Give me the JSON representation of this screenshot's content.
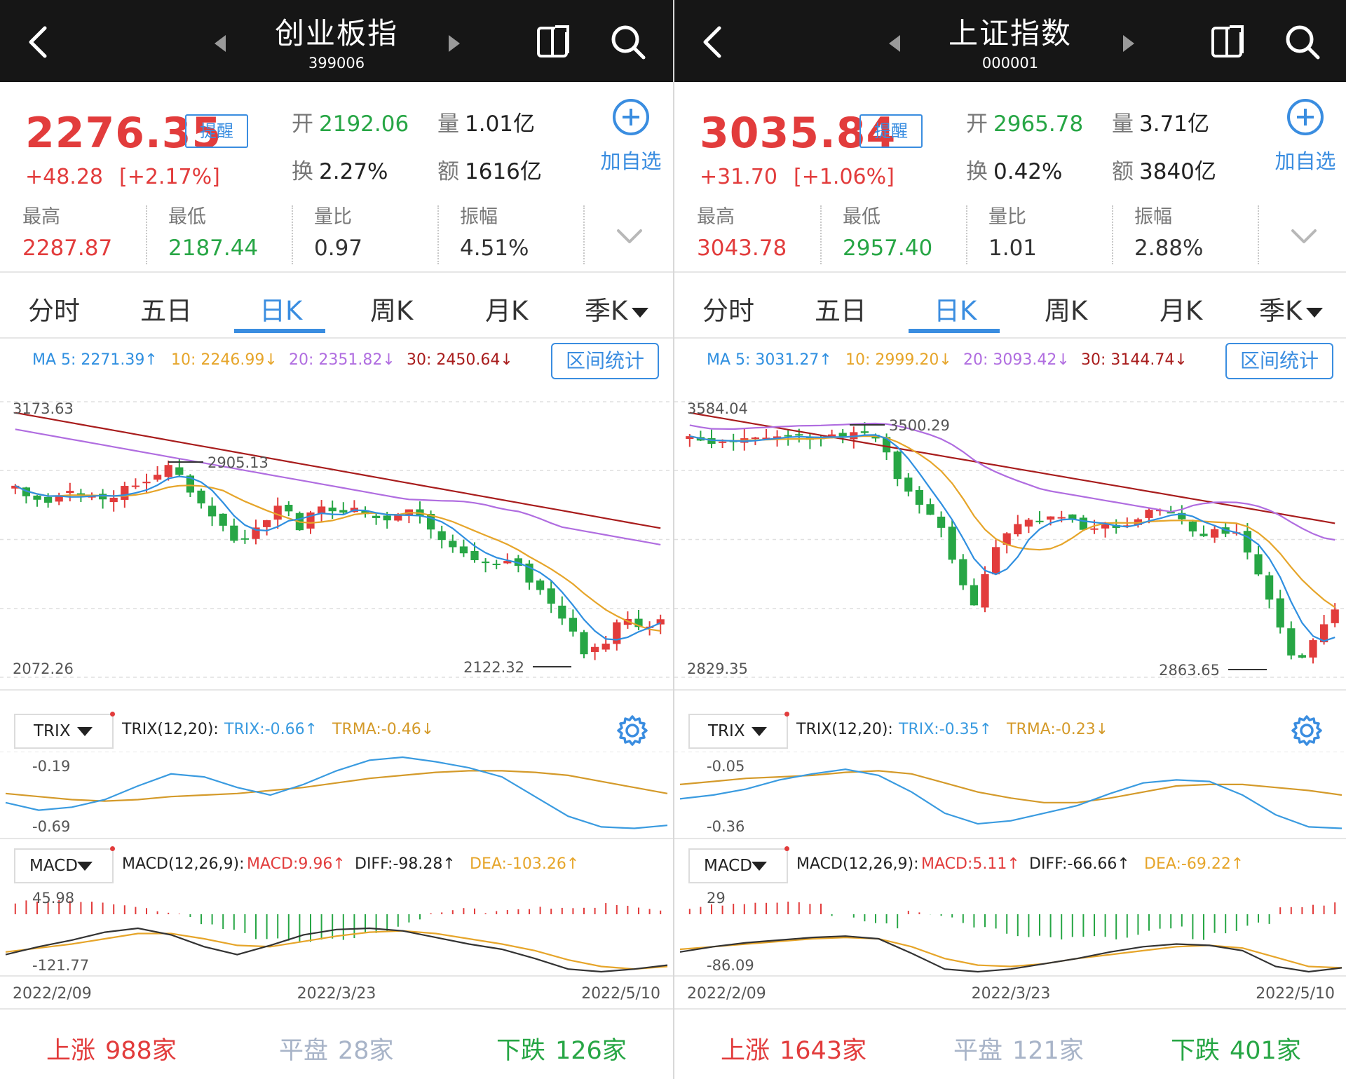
{
  "panels": [
    {
      "header": {
        "title": "创业板指",
        "code": "399006"
      },
      "quote": {
        "price": "2276.35",
        "alert_label": "提醒",
        "change": "+48.28",
        "change_pct": "[+2.17%]",
        "open_label": "开",
        "open": "2192.06",
        "volume_label": "量",
        "volume": "1.01亿",
        "turnover_label": "换",
        "turnover": "2.27%",
        "amount_label": "额",
        "amount": "1616亿",
        "add_fav_label": "加自选",
        "grid": [
          {
            "label": "最高",
            "value": "2287.87",
            "color": "red"
          },
          {
            "label": "最低",
            "value": "2187.44",
            "color": "green"
          },
          {
            "label": "量比",
            "value": "0.97",
            "color": "dark"
          },
          {
            "label": "振幅",
            "value": "4.51%",
            "color": "dark"
          }
        ]
      },
      "tabs": [
        "分时",
        "五日",
        "日K",
        "周K",
        "月K",
        "季K"
      ],
      "active_tab": "日K",
      "ma": {
        "ma5": "MA 5: 2271.39↑",
        "ma10": "10: 2246.99↓",
        "ma20": "20: 2351.82↓",
        "ma30": "30: 2450.64↓"
      },
      "range_btn": "区间统计",
      "kline": {
        "top_label": "3173.63",
        "bottom_label": "2072.26",
        "high_label": "2905.13",
        "low_label": "2122.32"
      },
      "trix": {
        "selector": "TRIX",
        "params": "TRIX(12,20):",
        "trix": "TRIX:-0.66↑",
        "trma": "TRMA:-0.46↓",
        "top": "-0.19",
        "bottom": "-0.69"
      },
      "macd": {
        "selector": "MACD",
        "params": "MACD(12,26,9):",
        "macd": "MACD:9.96↑",
        "diff": "DIFF:-98.28↑",
        "dea": "DEA:-103.26↑",
        "top": "45.98",
        "bottom": "-121.77"
      },
      "dates": [
        "2022/2/09",
        "2022/3/23",
        "2022/5/10"
      ],
      "footer": {
        "up_label": "上涨",
        "up": "988家",
        "flat_label": "平盘",
        "flat": "28家",
        "down_label": "下跌",
        "down": "126家"
      }
    },
    {
      "header": {
        "title": "上证指数",
        "code": "000001"
      },
      "quote": {
        "price": "3035.84",
        "alert_label": "提醒",
        "change": "+31.70",
        "change_pct": "[+1.06%]",
        "open_label": "开",
        "open": "2965.78",
        "volume_label": "量",
        "volume": "3.71亿",
        "turnover_label": "换",
        "turnover": "0.42%",
        "amount_label": "额",
        "amount": "3840亿",
        "add_fav_label": "加自选",
        "grid": [
          {
            "label": "最高",
            "value": "3043.78",
            "color": "red"
          },
          {
            "label": "最低",
            "value": "2957.40",
            "color": "green"
          },
          {
            "label": "量比",
            "value": "1.01",
            "color": "dark"
          },
          {
            "label": "振幅",
            "value": "2.88%",
            "color": "dark"
          }
        ]
      },
      "tabs": [
        "分时",
        "五日",
        "日K",
        "周K",
        "月K",
        "季K"
      ],
      "active_tab": "日K",
      "ma": {
        "ma5": "MA 5: 3031.27↑",
        "ma10": "10: 2999.20↓",
        "ma20": "20: 3093.42↓",
        "ma30": "30: 3144.74↓"
      },
      "range_btn": "区间统计",
      "kline": {
        "top_label": "3584.04",
        "bottom_label": "2829.35",
        "high_label": "3500.29",
        "low_label": "2863.65"
      },
      "trix": {
        "selector": "TRIX",
        "params": "TRIX(12,20):",
        "trix": "TRIX:-0.35↑",
        "trma": "TRMA:-0.23↓",
        "top": "-0.05",
        "bottom": "-0.36"
      },
      "macd": {
        "selector": "MACD",
        "params": "MACD(12,26,9):",
        "macd": "MACD:5.11↑",
        "diff": "DIFF:-66.66↑",
        "dea": "DEA:-69.22↑",
        "top": "29",
        "bottom": "-86.09"
      },
      "dates": [
        "2022/2/09",
        "2022/3/23",
        "2022/5/10"
      ],
      "footer": {
        "up_label": "上涨",
        "up": "1643家",
        "flat_label": "平盘",
        "flat": "121家",
        "down_label": "下跌",
        "down": "401家"
      }
    }
  ],
  "colors": {
    "header_bg": "#161616",
    "up": "#e23c3c",
    "down": "#27a645",
    "accent": "#3a8de0",
    "ma5": "#2f8fe0",
    "ma10": "#e6a52a",
    "ma20": "#b06de0",
    "ma30": "#a81c1c",
    "trix": "#3a9be0",
    "trma": "#d49a2a",
    "diff": "#333333",
    "dea": "#e6a52a"
  },
  "icons": {
    "back": "chevron-left-icon",
    "prev": "caret-left-icon",
    "next": "caret-right-icon",
    "split": "split-screen-icon",
    "search": "search-icon",
    "add": "plus-circle-icon",
    "expand": "chevron-down-icon",
    "settings": "gear-icon"
  }
}
